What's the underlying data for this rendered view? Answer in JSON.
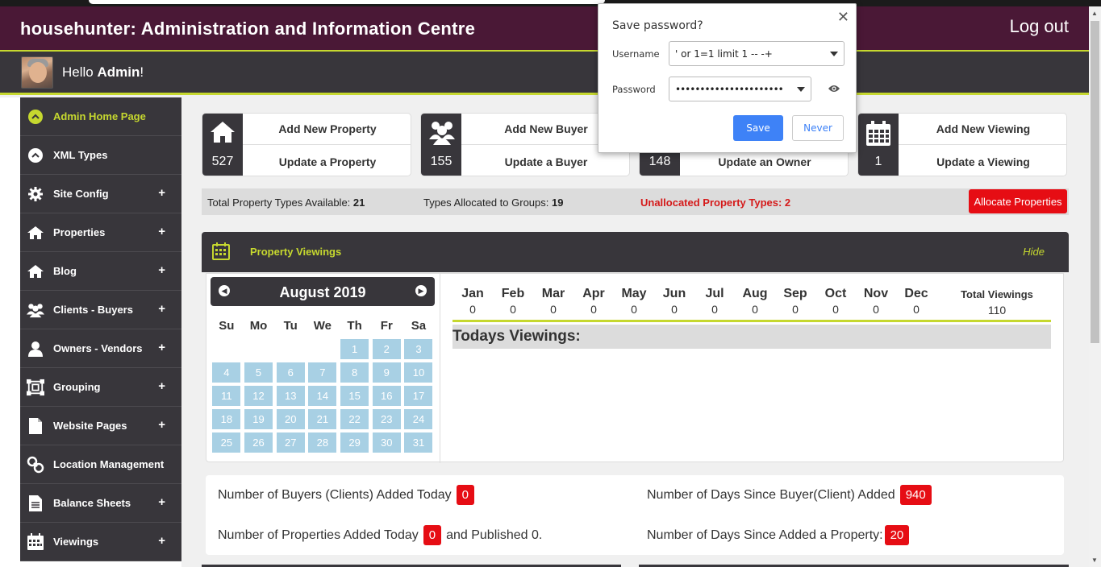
{
  "header": {
    "title": "househunter: Administration and Information Centre",
    "logout": "Log out"
  },
  "user": {
    "greeting": "Hello",
    "name": "Admin",
    "suffix": "!"
  },
  "sidebar": {
    "items": [
      {
        "label": "Admin Home Page",
        "icon": "chevron-up-circle-icon",
        "expandable": ""
      },
      {
        "label": "XML Types",
        "icon": "chevron-up-circle-icon",
        "expandable": ""
      },
      {
        "label": "Site Config",
        "icon": "gear-icon",
        "expandable": "+"
      },
      {
        "label": "Properties",
        "icon": "home-icon",
        "expandable": "+"
      },
      {
        "label": "Blog",
        "icon": "home-icon",
        "expandable": "+"
      },
      {
        "label": "Clients - Buyers",
        "icon": "users-icon",
        "expandable": "+"
      },
      {
        "label": "Owners - Vendors",
        "icon": "user-icon",
        "expandable": "+"
      },
      {
        "label": "Grouping",
        "icon": "group-icon",
        "expandable": "+"
      },
      {
        "label": "Website Pages",
        "icon": "file-icon",
        "expandable": "+"
      },
      {
        "label": "Location Management",
        "icon": "link-icon",
        "expandable": ""
      },
      {
        "label": "Balance Sheets",
        "icon": "document-icon",
        "expandable": "+"
      },
      {
        "label": "Viewings",
        "icon": "calendar-icon",
        "expandable": "+"
      }
    ]
  },
  "tiles": [
    {
      "count": "527",
      "add": "Add New Property",
      "update": "Update a Property",
      "icon": "home-icon"
    },
    {
      "count": "155",
      "add": "Add New Buyer",
      "update": "Update a Buyer",
      "icon": "users-icon"
    },
    {
      "count": "148",
      "add": "",
      "update": "Update an Owner",
      "icon": "user-icon"
    },
    {
      "count": "1",
      "add": "Add New Viewing",
      "update": "Update a Viewing",
      "icon": "calendar-icon"
    }
  ],
  "stats": {
    "total_label": "Total Property Types Available:",
    "total_value": "21",
    "allocated_label": "Types Allocated to Groups:",
    "allocated_value": "19",
    "unallocated": "Unallocated Property Types: 2",
    "allocate_button": "Allocate Properties"
  },
  "viewings_panel": {
    "title": "Property Viewings",
    "hide": "Hide"
  },
  "calendar": {
    "month": "August 2019",
    "weekdays": [
      "Su",
      "Mo",
      "Tu",
      "We",
      "Th",
      "Fr",
      "Sa"
    ],
    "weeks": [
      [
        "",
        "",
        "",
        "",
        "1",
        "2",
        "3"
      ],
      [
        "4",
        "5",
        "6",
        "7",
        "8",
        "9",
        "10"
      ],
      [
        "11",
        "12",
        "13",
        "14",
        "15",
        "16",
        "17"
      ],
      [
        "18",
        "19",
        "20",
        "21",
        "22",
        "23",
        "24"
      ],
      [
        "25",
        "26",
        "27",
        "28",
        "29",
        "30",
        "31"
      ]
    ]
  },
  "monthly": {
    "months": [
      "Jan",
      "Feb",
      "Mar",
      "Apr",
      "May",
      "Jun",
      "Jul",
      "Aug",
      "Sep",
      "Oct",
      "Nov",
      "Dec"
    ],
    "values": [
      "0",
      "0",
      "0",
      "0",
      "0",
      "0",
      "0",
      "0",
      "0",
      "0",
      "0",
      "0"
    ],
    "total_label": "Total Viewings",
    "total_value": "110"
  },
  "todays_viewings": "Todays Viewings:",
  "summary": {
    "buyers_today_label": "Number of Buyers (Clients) Added Today",
    "buyers_today": "0",
    "days_since_buyer_label": "Number of Days Since Buyer(Client) Added",
    "days_since_buyer": "940",
    "properties_today_label": "Number of Properties Added Today",
    "properties_today": "0",
    "published_text": "and Published 0.",
    "days_since_property_label": "Number of Days Since Added a Property:",
    "days_since_property": "20"
  },
  "password_popup": {
    "title": "Save password?",
    "username_label": "Username",
    "username_value": "' or 1=1 limit 1 -- -+",
    "password_label": "Password",
    "password_value": "••••••••••••••••••••••",
    "save": "Save",
    "never": "Never"
  },
  "colors": {
    "accent": "#c6d82f",
    "header_bg": "#4a1836",
    "dark": "#38363b",
    "badge": "#e60d14",
    "calendar_day": "#a8d0e4"
  }
}
